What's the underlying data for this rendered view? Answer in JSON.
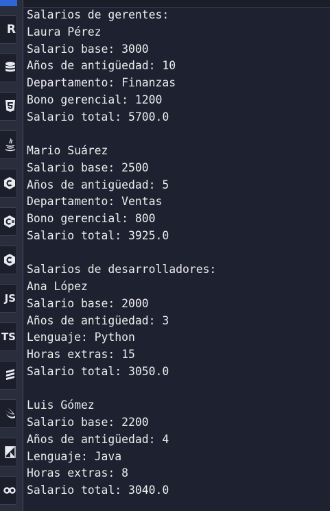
{
  "sidebar": {
    "items": [
      {
        "name": "r-language",
        "glyph": "R"
      },
      {
        "name": "database",
        "glyph": ""
      },
      {
        "name": "html5",
        "glyph": ""
      },
      {
        "name": "java",
        "glyph": ""
      },
      {
        "name": "cpp",
        "glyph": ""
      },
      {
        "name": "csharp",
        "glyph": ""
      },
      {
        "name": "c-language",
        "glyph": ""
      },
      {
        "name": "javascript",
        "glyph": "JS"
      },
      {
        "name": "typescript",
        "glyph": "TS"
      },
      {
        "name": "sass",
        "glyph": ""
      },
      {
        "name": "swift",
        "glyph": ""
      },
      {
        "name": "kotlin",
        "glyph": ""
      },
      {
        "name": "go",
        "glyph": "GO"
      }
    ]
  },
  "console": {
    "lines": [
      "Salarios de gerentes:",
      "Laura Pérez",
      "Salario base: 3000",
      "Años de antigüedad: 10",
      "Departamento: Finanzas",
      "Bono gerencial: 1200",
      "Salario total: 5700.0",
      "",
      "Mario Suárez",
      "Salario base: 2500",
      "Años de antigüedad: 5",
      "Departamento: Ventas",
      "Bono gerencial: 800",
      "Salario total: 3925.0",
      "",
      "Salarios de desarrolladores:",
      "Ana López",
      "Salario base: 2000",
      "Años de antigüedad: 3",
      "Lenguaje: Python",
      "Horas extras: 15",
      "Salario total: 3050.0",
      "",
      "Luis Gómez",
      "Salario base: 2200",
      "Años de antigüedad: 4",
      "Lenguaje: Java",
      "Horas extras: 8",
      "Salario total: 3040.0"
    ]
  }
}
